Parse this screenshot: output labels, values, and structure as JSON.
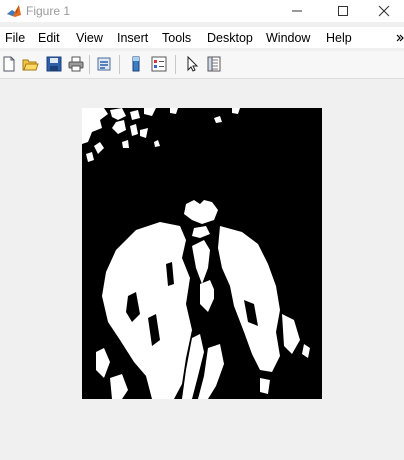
{
  "window": {
    "title": "Figure 1",
    "controls": [
      "minimize",
      "maximize",
      "close"
    ]
  },
  "menubar": {
    "items": [
      "File",
      "Edit",
      "View",
      "Insert",
      "Tools",
      "Desktop",
      "Window",
      "Help"
    ]
  },
  "toolbar": {
    "buttons": [
      "new-figure-icon",
      "open-file-icon",
      "save-icon",
      "print-icon",
      "link-plot-icon",
      "colorbar-icon",
      "legend-icon",
      "edit-plot-icon",
      "property-inspector-icon"
    ]
  },
  "figure": {
    "image_type": "binary thresholded image",
    "colors": {
      "background": "#000000",
      "foreground": "#ffffff"
    }
  },
  "colors": {
    "window_bg": "#f0f0f0",
    "chrome": "#ffffff",
    "matlab_orange": "#e06c1d"
  }
}
